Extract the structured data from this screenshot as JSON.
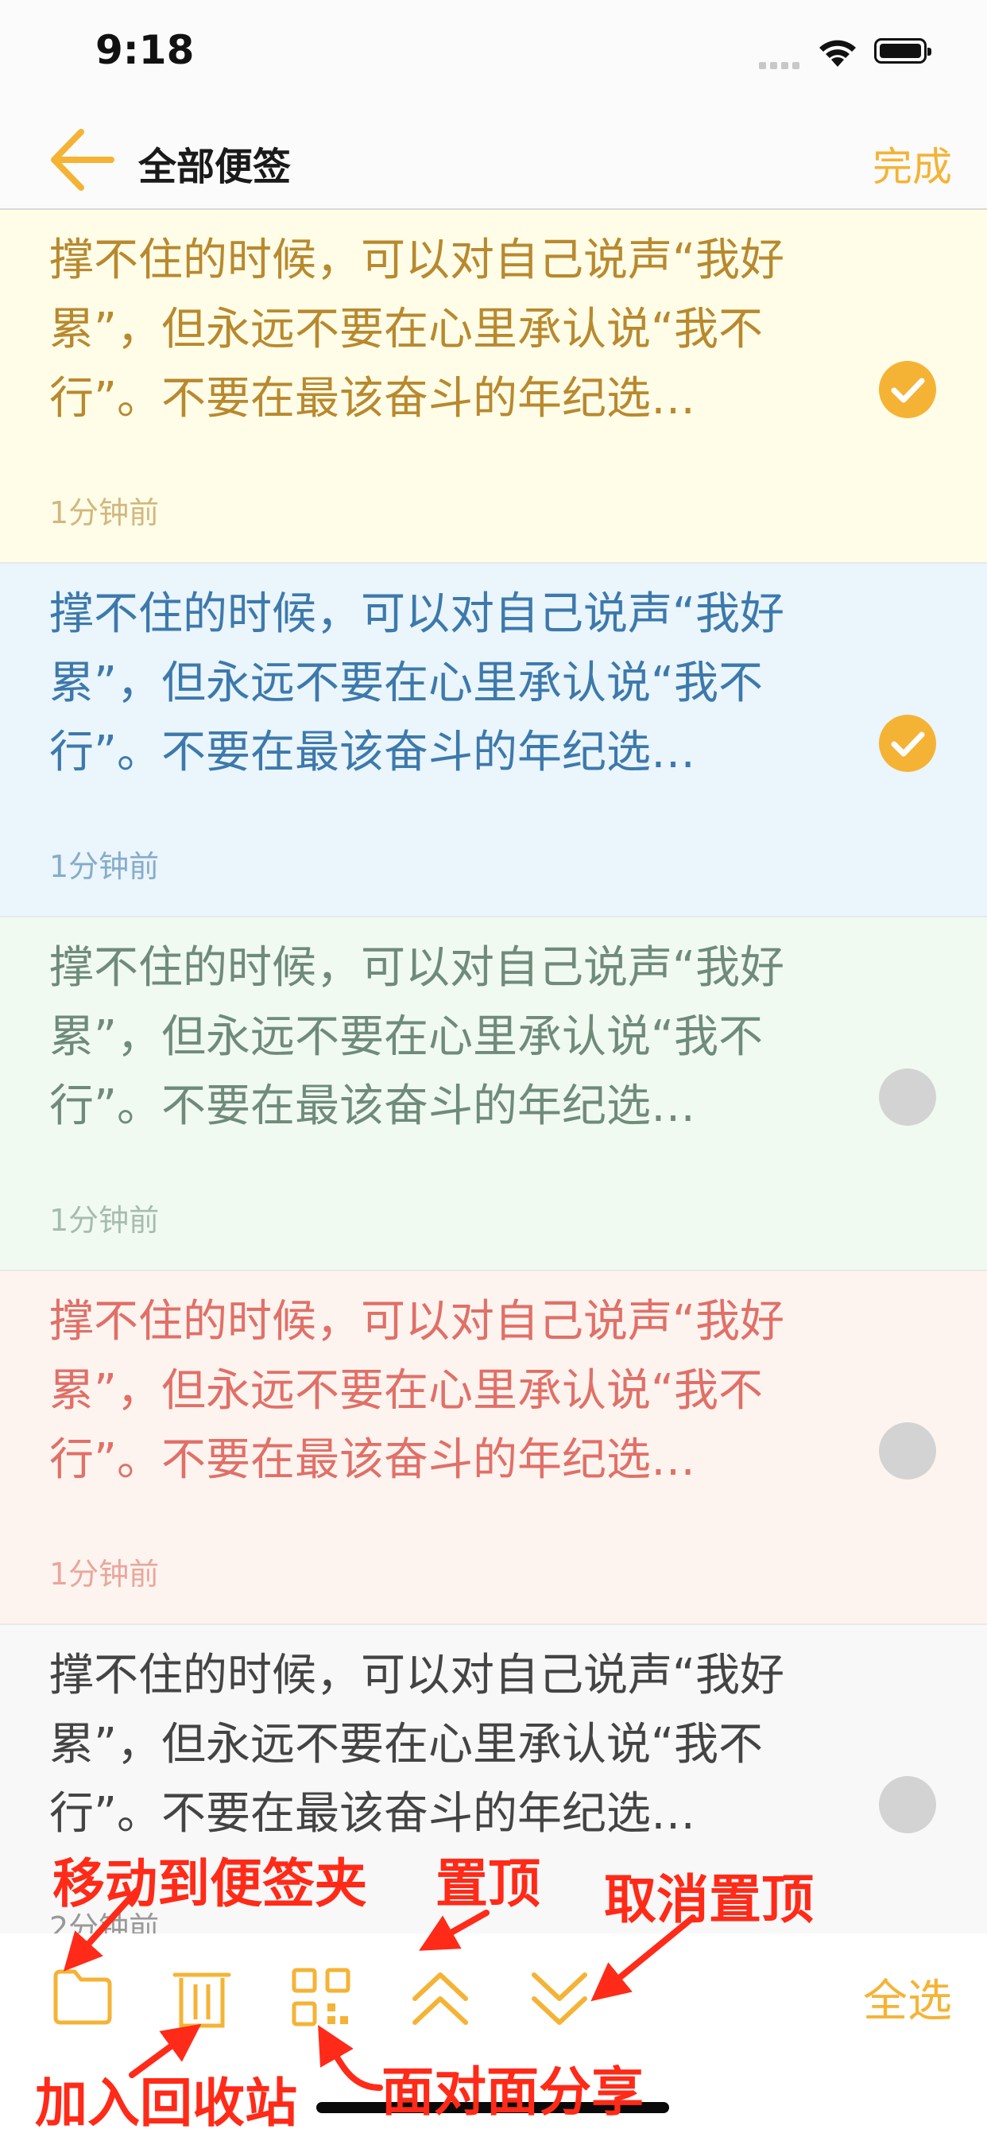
{
  "status_bar": {
    "time": "9:18"
  },
  "nav": {
    "title": "全部便签",
    "done_label": "完成"
  },
  "notes": [
    {
      "text": "撑不住的时候，可以对自己说声“我好累”，但永远不要在心里承认说“我不行”。不要在最该奋斗的年纪选…",
      "time": "1分钟前",
      "selected": true,
      "bg": "#fffde8",
      "text_color": "#b8892e",
      "time_color": "#d2b77e"
    },
    {
      "text": "撑不住的时候，可以对自己说声“我好累”，但永远不要在心里承认说“我不行”。不要在最该奋斗的年纪选…",
      "time": "1分钟前",
      "selected": true,
      "bg": "#eaf5fc",
      "text_color": "#3d79ab",
      "time_color": "#87acc9"
    },
    {
      "text": "撑不住的时候，可以对自己说声“我好累”，但永远不要在心里承认说“我不行”。不要在最该奋斗的年纪选…",
      "time": "1分钟前",
      "selected": false,
      "bg": "#f1faf1",
      "text_color": "#6f8b7a",
      "time_color": "#a8bcae"
    },
    {
      "text": "撑不住的时候，可以对自己说声“我好累”，但永远不要在心里承认说“我不行”。不要在最该奋斗的年纪选…",
      "time": "1分钟前",
      "selected": false,
      "bg": "#fef4ef",
      "text_color": "#e07068",
      "time_color": "#e8a79d"
    },
    {
      "text": "撑不住的时候，可以对自己说声“我好累”，但永远不要在心里承认说“我不行”。不要在最该奋斗的年纪选…",
      "time": "2分钟前",
      "selected": false,
      "bg": "#f8f8f8",
      "text_color": "#444444",
      "time_color": "#999999"
    }
  ],
  "toolbar": {
    "select_all_label": "全选"
  },
  "annotations": {
    "move_to_folder": "移动到便签夹",
    "pin_top": "置顶",
    "unpin": "取消置顶",
    "add_to_trash": "加入回收站",
    "face_share": "面对面分享"
  },
  "colors": {
    "accent": "#f5b335",
    "unchecked": "#d3d3d3",
    "annotation": "#ff2a18"
  },
  "icons": [
    "back-arrow-icon",
    "check-icon",
    "folder-icon",
    "trash-icon",
    "qr-code-icon",
    "pin-top-icon",
    "unpin-icon",
    "wifi-icon",
    "battery-icon"
  ]
}
